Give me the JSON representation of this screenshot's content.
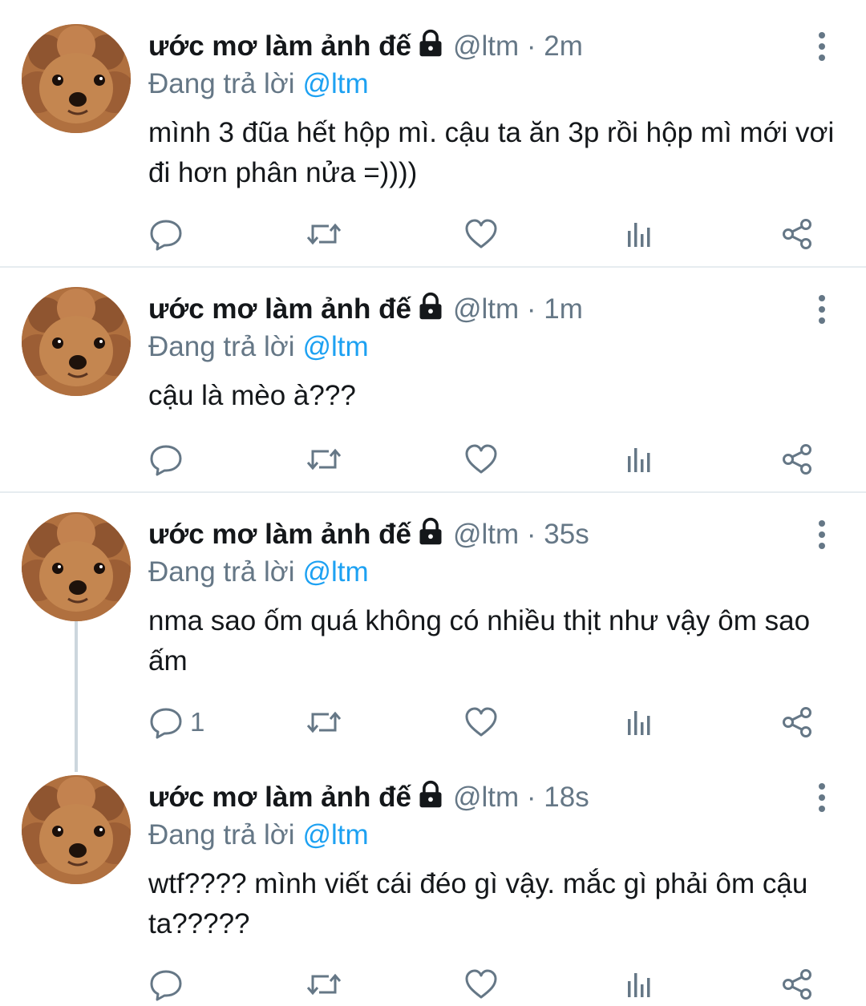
{
  "colors": {
    "text": "#14171a",
    "secondary": "#657786",
    "link": "#1da1f2",
    "divider": "#e6ecf0",
    "thread_line": "#ccd6dd"
  },
  "tweets": [
    {
      "name": "ước mơ làm ảnh đế",
      "handle_time": "@ltm · 2m",
      "replying_prefix": "Đang trả lời",
      "replying_to": "@ltm",
      "text": "mình 3 đũa hết hộp mì. cậu ta ăn 3p rồi hộp mì mới vơi đi hơn phân nửa =))))",
      "reply_count": ""
    },
    {
      "name": "ước mơ làm ảnh đế",
      "handle_time": "@ltm · 1m",
      "replying_prefix": "Đang trả lời",
      "replying_to": "@ltm",
      "text": "cậu là mèo à???",
      "reply_count": ""
    },
    {
      "name": "ước mơ làm ảnh đế",
      "handle_time": "@ltm · 35s",
      "replying_prefix": "Đang trả lời",
      "replying_to": "@ltm",
      "text": "nma sao ốm quá không có nhiều thịt như vậy ôm sao ấm",
      "reply_count": "1"
    },
    {
      "name": "ước mơ làm ảnh đế",
      "handle_time": "@ltm · 18s",
      "replying_prefix": "Đang trả lời",
      "replying_to": "@ltm",
      "text": "wtf???? mình viết cái đéo gì vậy. mắc gì phải ôm cậu ta?????",
      "reply_count": ""
    }
  ],
  "icons": {
    "avatar": "poodle-avatar",
    "lock": "lock-icon",
    "menu": "more-vertical-icon",
    "reply": "reply-icon",
    "retweet": "retweet-icon",
    "like": "heart-icon",
    "analytics": "analytics-icon",
    "share": "share-icon"
  }
}
